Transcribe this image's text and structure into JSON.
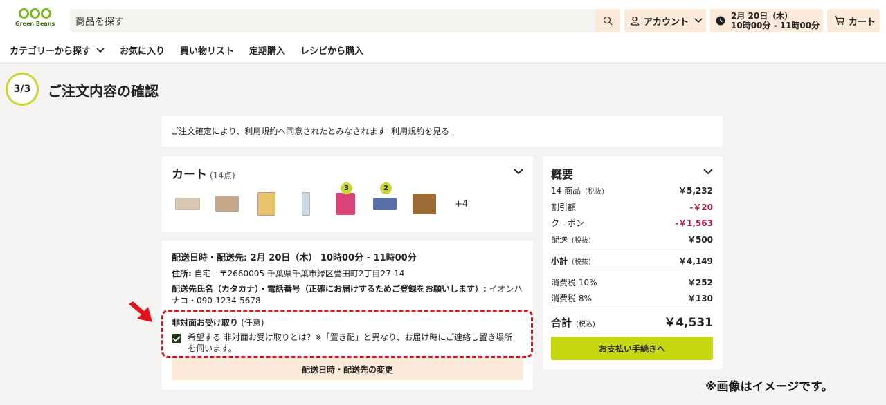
{
  "header": {
    "logo_text": "Green Beans",
    "search_placeholder": "商品を探す",
    "account_label": "アカウント",
    "delivery_line1": "2月 20日（木）",
    "delivery_line2": "10時00分 - 11時00分",
    "cart_label": "カート"
  },
  "nav": {
    "items": [
      "カテゴリーから探す",
      "お気に入り",
      "買い物リスト",
      "定期購入",
      "レシピから購入"
    ]
  },
  "page": {
    "step": "3/3",
    "title": "ご注文内容の確認"
  },
  "terms": {
    "text": "ご注文確定により、利用規約へ同意されたとみなされます",
    "link": "利用規約を見る"
  },
  "cart": {
    "title": "カート",
    "count": "(14点)",
    "badges": [
      "3",
      "2"
    ],
    "more": "+4",
    "thumb_colors": [
      "#d9c7b4",
      "#c7a88a",
      "#e8c56a",
      "#9fb3c5",
      "#d9457a",
      "#5a6fa8",
      "#9c6a35"
    ]
  },
  "delivery": {
    "title": "配送日時・配送先: 2月 20日（木） 10時00分 - 11時00分",
    "addr_label": "住所:",
    "addr_value": "自宅 - 〒2660005 千葉県千葉市緑区誉田町2丁目27-14",
    "name_label": "配送先氏名（カタカナ）・電話番号（正確にお届けするためご登録をお願いします）:",
    "name_value": "イオンハナコ・090-1234-5678",
    "nonface_label": "非対面お受け取り",
    "nonface_optional": "(任意)",
    "nonface_check_text": "希望する",
    "nonface_link": "非対面お受け取りとは？※「置き配」と異なり、お届け時にご連絡し置き場所を伺います。",
    "change_button": "配送日時・配送先の変更"
  },
  "summary": {
    "title": "概要",
    "items_label": "14 商品",
    "items_tax": "(税抜)",
    "items_value": "￥5,232",
    "discount_label": "割引額",
    "discount_value": "-￥20",
    "coupon_label": "クーポン",
    "coupon_value": "-￥1,563",
    "shipping_label": "配送",
    "shipping_tax": "(税抜)",
    "shipping_value": "￥500",
    "subtotal_label": "小計",
    "subtotal_tax": "(税抜)",
    "subtotal_value": "￥4,149",
    "tax10_label": "消費税 10%",
    "tax10_value": "￥252",
    "tax8_label": "消費税 8%",
    "tax8_value": "￥130",
    "total_label": "合計",
    "total_tax": "(税込)",
    "total_value": "￥4,531",
    "pay_button": "お支払い手続きへ"
  },
  "note": "※画像はイメージです。",
  "colors": {
    "accent": "#c8d810",
    "highlight": "#e4111b",
    "button_bg": "#fbe9d9"
  }
}
